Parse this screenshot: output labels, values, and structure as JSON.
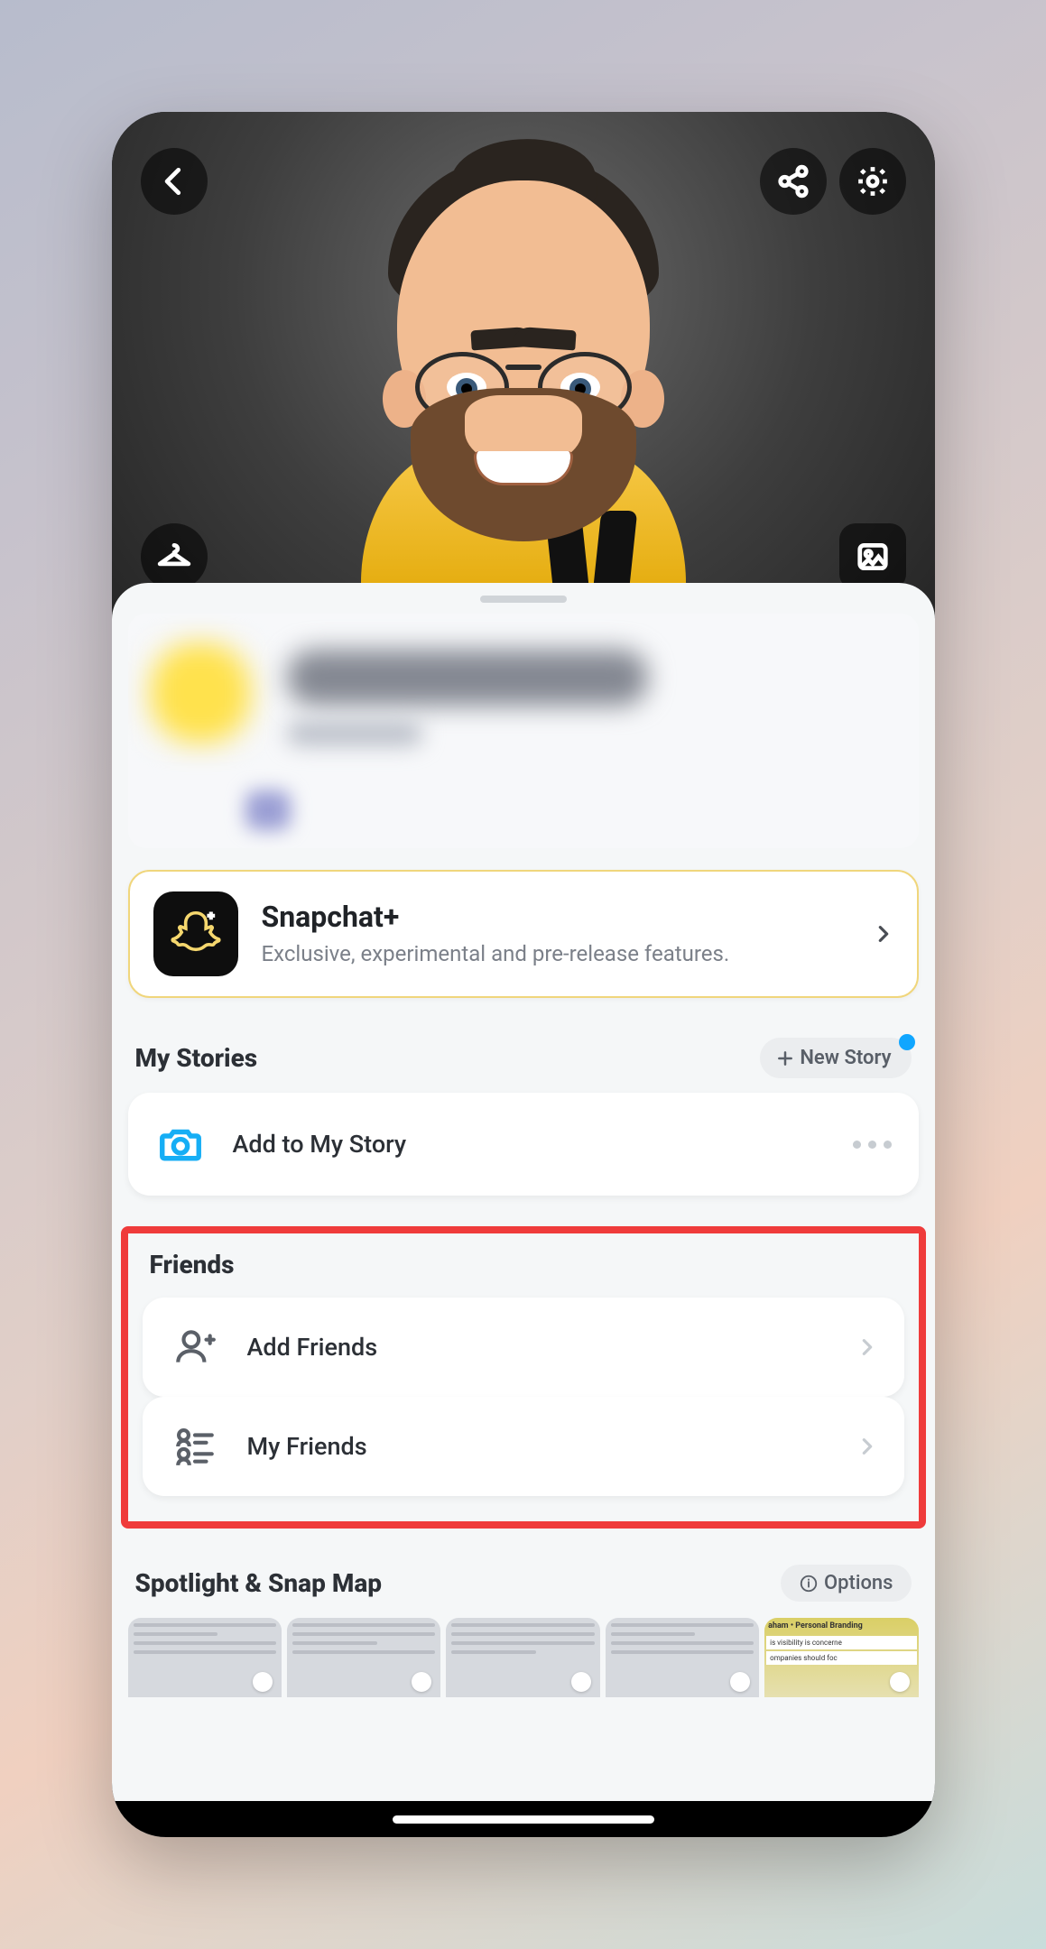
{
  "snapchat_plus": {
    "title": "Snapchat+",
    "subtitle": "Exclusive, experimental and pre-release features."
  },
  "sections": {
    "my_stories": {
      "title": "My Stories",
      "new_story_label": "New Story",
      "add_label": "Add to My Story"
    },
    "friends": {
      "title": "Friends",
      "add_label": "Add Friends",
      "my_label": "My Friends"
    },
    "spotlight": {
      "title": "Spotlight & Snap Map",
      "options_label": "Options"
    }
  },
  "thumbs": {
    "brand_heading": "aham • Personal Branding",
    "brand_line1": "is visibility is concerne",
    "brand_line2": "ompanies should foc"
  }
}
